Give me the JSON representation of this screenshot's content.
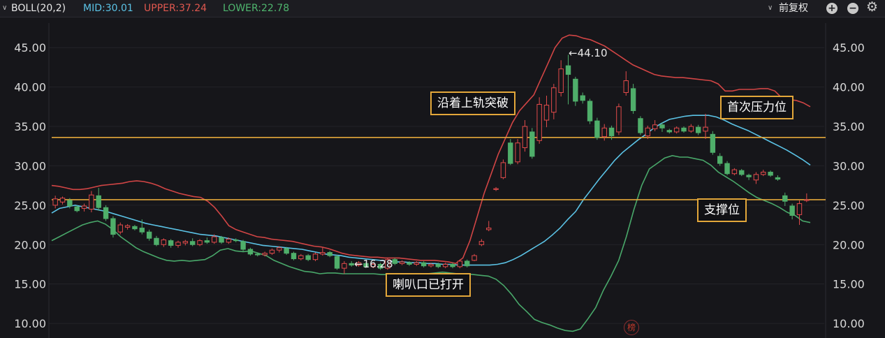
{
  "header": {
    "indicator_label": "BOLL(20,2)",
    "mid_label": "MID:30.01",
    "upper_label": "UPPER:37.24",
    "lower_label": "LOWER:22.78",
    "adjust_label": "前复权"
  },
  "colors": {
    "background": "#16161a",
    "up": "#e24b4b",
    "down": "#4fae6a",
    "upper_band": "#d14545",
    "mid_band": "#5bc3e6",
    "lower_band": "#49a86a",
    "reference_line": "#e3a73a",
    "mid_text": "#5bc3e6",
    "upper_text": "#e0584f",
    "lower_text": "#4fb66e"
  },
  "icons": [
    "chevron-down-icon",
    "chevron-down-icon",
    "zoom-in-icon",
    "zoom-out-icon",
    "gear-icon"
  ],
  "annotations": {
    "breakout": "沿着上轨突破",
    "pressure": "首次压力位",
    "horn": "喇叭口已打开",
    "support": "支撑位",
    "high_mark": "←44.10",
    "low_mark": "←16.28"
  },
  "watermark": "榜",
  "chart_data": {
    "type": "candlestick",
    "ylim": [
      8.5,
      47.5
    ],
    "y_ticks": [
      "45.00",
      "40.00",
      "35.00",
      "30.00",
      "25.00",
      "20.00",
      "15.00",
      "10.00"
    ],
    "y_tick_values": [
      45,
      40,
      35,
      30,
      25,
      20,
      15,
      10
    ],
    "reference_lines": [
      33.6,
      25.7
    ],
    "candles": [
      [
        25.0,
        25.8,
        24.6,
        26.2
      ],
      [
        25.4,
        25.9,
        25.1,
        26.1
      ],
      [
        25.6,
        24.9,
        24.6,
        25.9
      ],
      [
        24.8,
        24.3,
        24.1,
        25.0
      ],
      [
        24.6,
        24.9,
        24.2,
        25.2
      ],
      [
        24.5,
        26.3,
        24.1,
        26.8
      ],
      [
        26.2,
        24.7,
        24.3,
        27.2
      ],
      [
        24.7,
        23.3,
        23.0,
        25.0
      ],
      [
        23.3,
        21.3,
        20.9,
        23.6
      ],
      [
        21.6,
        22.5,
        21.3,
        22.8
      ],
      [
        22.2,
        22.4,
        21.9,
        22.6
      ],
      [
        22.3,
        22.0,
        21.8,
        22.5
      ],
      [
        22.1,
        21.6,
        21.3,
        23.2
      ],
      [
        21.6,
        20.8,
        20.5,
        21.9
      ],
      [
        20.8,
        20.0,
        19.8,
        21.1
      ],
      [
        20.0,
        20.6,
        19.7,
        20.8
      ],
      [
        20.5,
        19.9,
        19.6,
        20.7
      ],
      [
        19.9,
        20.3,
        19.6,
        20.5
      ],
      [
        20.2,
        20.4,
        19.9,
        20.6
      ],
      [
        20.4,
        20.0,
        19.8,
        20.8
      ],
      [
        20.0,
        20.5,
        19.8,
        20.7
      ],
      [
        20.5,
        20.3,
        20.1,
        20.9
      ],
      [
        20.3,
        21.0,
        20.1,
        21.3
      ],
      [
        20.9,
        20.3,
        20.1,
        21.1
      ],
      [
        20.3,
        20.7,
        20.1,
        20.9
      ],
      [
        20.6,
        20.5,
        20.3,
        20.8
      ],
      [
        20.4,
        19.4,
        19.1,
        20.6
      ],
      [
        19.4,
        18.8,
        18.6,
        19.6
      ],
      [
        18.8,
        18.7,
        18.5,
        19.0
      ],
      [
        18.7,
        18.9,
        18.5,
        19.1
      ],
      [
        18.9,
        19.3,
        18.7,
        19.5
      ],
      [
        19.3,
        19.6,
        19.0,
        19.8
      ],
      [
        19.5,
        18.9,
        18.7,
        19.7
      ],
      [
        18.9,
        18.2,
        18.0,
        19.1
      ],
      [
        18.2,
        18.6,
        18.0,
        18.8
      ],
      [
        18.6,
        18.1,
        17.9,
        18.8
      ],
      [
        18.1,
        18.8,
        17.9,
        19.0
      ],
      [
        18.8,
        19.0,
        18.6,
        19.6
      ],
      [
        19.0,
        18.6,
        18.4,
        19.2
      ],
      [
        18.5,
        17.0,
        16.8,
        18.7
      ],
      [
        17.0,
        17.6,
        16.3,
        17.9
      ],
      [
        17.6,
        17.4,
        17.2,
        17.9
      ],
      [
        17.4,
        17.7,
        17.2,
        17.9
      ],
      [
        17.6,
        17.2,
        17.0,
        17.8
      ],
      [
        17.2,
        17.5,
        17.0,
        17.7
      ],
      [
        17.5,
        17.0,
        16.8,
        17.7
      ],
      [
        17.0,
        18.1,
        16.8,
        18.3
      ],
      [
        18.1,
        17.6,
        17.4,
        18.3
      ],
      [
        17.6,
        17.8,
        17.4,
        18.0
      ],
      [
        17.7,
        17.5,
        17.3,
        17.9
      ],
      [
        17.5,
        17.7,
        17.3,
        17.9
      ],
      [
        17.7,
        17.3,
        17.1,
        17.9
      ],
      [
        17.3,
        17.5,
        17.1,
        17.7
      ],
      [
        17.5,
        17.2,
        17.0,
        17.7
      ],
      [
        17.2,
        17.5,
        17.0,
        17.7
      ],
      [
        17.5,
        17.2,
        17.0,
        17.7
      ],
      [
        17.2,
        17.9,
        17.0,
        18.1
      ],
      [
        17.9,
        17.3,
        17.1,
        18.1
      ],
      [
        18.0,
        18.6,
        17.9,
        18.8
      ],
      [
        20.0,
        20.4,
        19.8,
        20.7
      ],
      [
        21.9,
        22.1,
        21.7,
        23.0
      ],
      [
        27.0,
        27.1,
        26.8,
        27.3
      ],
      [
        28.5,
        30.4,
        28.3,
        30.8
      ],
      [
        32.9,
        30.3,
        30.1,
        33.4
      ],
      [
        30.5,
        32.9,
        30.2,
        33.4
      ],
      [
        32.3,
        35.0,
        31.8,
        35.8
      ],
      [
        34.3,
        31.2,
        30.9,
        34.8
      ],
      [
        33.2,
        37.8,
        32.8,
        38.7
      ],
      [
        35.8,
        37.7,
        34.9,
        38.9
      ],
      [
        36.8,
        39.9,
        35.9,
        40.4
      ],
      [
        39.3,
        42.3,
        38.8,
        43.4
      ],
      [
        42.7,
        41.6,
        37.8,
        44.1
      ],
      [
        41.0,
        38.2,
        37.6,
        41.3
      ],
      [
        38.9,
        38.3,
        37.9,
        39.3
      ],
      [
        38.2,
        35.7,
        35.3,
        38.5
      ],
      [
        35.7,
        33.6,
        33.3,
        36.1
      ],
      [
        33.7,
        34.8,
        33.2,
        35.3
      ],
      [
        34.8,
        33.8,
        33.3,
        35.1
      ],
      [
        34.3,
        37.5,
        33.9,
        37.9
      ],
      [
        39.3,
        40.8,
        38.9,
        42.0
      ],
      [
        39.8,
        37.0,
        36.6,
        40.4
      ],
      [
        36.0,
        34.2,
        33.9,
        36.3
      ],
      [
        33.8,
        34.8,
        33.4,
        35.1
      ],
      [
        34.7,
        35.2,
        34.4,
        35.8
      ],
      [
        35.2,
        34.8,
        34.3,
        35.5
      ],
      [
        34.5,
        34.3,
        34.1,
        34.7
      ],
      [
        34.3,
        34.8,
        34.1,
        35.0
      ],
      [
        34.8,
        34.4,
        34.2,
        35.0
      ],
      [
        34.4,
        35.0,
        34.2,
        35.3
      ],
      [
        34.9,
        34.2,
        33.9,
        35.2
      ],
      [
        34.4,
        34.9,
        33.4,
        36.6
      ],
      [
        34.0,
        31.7,
        31.4,
        34.4
      ],
      [
        31.2,
        30.3,
        30.0,
        31.6
      ],
      [
        30.3,
        29.0,
        28.8,
        30.6
      ],
      [
        29.0,
        29.5,
        28.8,
        29.7
      ],
      [
        29.4,
        28.9,
        28.7,
        29.6
      ],
      [
        28.8,
        28.6,
        28.2,
        29.0
      ],
      [
        28.2,
        28.9,
        27.7,
        29.2
      ],
      [
        28.9,
        29.2,
        28.7,
        29.5
      ],
      [
        29.2,
        28.8,
        28.6,
        29.4
      ],
      [
        28.5,
        28.3,
        28.1,
        28.8
      ],
      [
        26.2,
        25.5,
        24.9,
        26.6
      ],
      [
        24.9,
        23.7,
        23.2,
        25.2
      ],
      [
        23.8,
        25.2,
        22.5,
        25.6
      ],
      [
        25.6,
        25.7,
        25.4,
        26.5
      ]
    ],
    "upper_band": [
      27.5,
      27.4,
      27.2,
      27.0,
      27.0,
      27.1,
      27.3,
      27.5,
      27.6,
      27.7,
      27.8,
      28.0,
      28.1,
      28.0,
      27.8,
      27.5,
      27.1,
      26.8,
      26.5,
      26.3,
      26.1,
      26.0,
      25.5,
      24.7,
      23.6,
      22.4,
      21.9,
      21.6,
      21.3,
      21.0,
      20.9,
      20.7,
      20.6,
      20.5,
      20.4,
      20.2,
      20.0,
      19.8,
      19.7,
      19.5,
      19.2,
      18.9,
      18.7,
      18.6,
      18.5,
      18.4,
      18.4,
      18.3,
      18.3,
      18.3,
      18.2,
      18.1,
      18.0,
      18.0,
      18.0,
      17.9,
      17.8,
      17.6,
      18.3,
      20.5,
      23.5,
      26.5,
      29.0,
      31.5,
      33.5,
      35.5,
      37.0,
      38.0,
      39.0,
      41.0,
      43.0,
      45.0,
      46.2,
      46.6,
      46.5,
      46.2,
      46.0,
      45.6,
      45.2,
      44.6,
      44.0,
      43.4,
      42.8,
      42.4,
      42.0,
      41.6,
      41.4,
      41.3,
      41.2,
      41.2,
      41.1,
      41.0,
      40.9,
      40.8,
      40.4,
      39.5,
      39.5,
      39.7,
      39.7,
      39.7,
      39.8,
      39.8,
      39.5,
      38.6,
      38.4,
      38.3,
      38.0,
      37.5
    ],
    "mid_band": [
      24.0,
      24.6,
      24.8,
      25.0,
      24.8,
      24.6,
      24.4,
      24.2,
      23.9,
      23.6,
      23.3,
      23.0,
      22.7,
      22.5,
      22.3,
      22.1,
      21.9,
      21.7,
      21.5,
      21.3,
      21.2,
      21.1,
      20.9,
      20.7,
      20.5,
      20.3,
      20.1,
      19.9,
      19.8,
      19.7,
      19.6,
      19.5,
      19.4,
      19.2,
      19.0,
      18.8,
      18.7,
      18.6,
      18.4,
      18.3,
      18.2,
      18.1,
      18.0,
      17.9,
      17.8,
      17.8,
      17.7,
      17.7,
      17.6,
      17.6,
      17.5,
      17.5,
      17.4,
      17.4,
      17.4,
      17.4,
      17.4,
      17.5,
      17.7,
      18.1,
      18.6,
      19.2,
      19.8,
      20.4,
      21.2,
      22.1,
      23.2,
      24.2,
      25.7,
      27.0,
      28.3,
      29.5,
      30.7,
      31.7,
      32.5,
      33.3,
      34.0,
      34.8,
      35.4,
      35.9,
      36.1,
      36.3,
      36.4,
      36.4,
      36.4,
      36.2,
      35.8,
      35.3,
      34.9,
      34.5,
      34.0,
      33.5,
      33.0,
      32.5,
      32.0,
      31.4,
      30.8,
      30.1
    ],
    "lower_band": [
      20.5,
      21.0,
      21.5,
      22.0,
      22.5,
      22.8,
      23.0,
      22.6,
      21.9,
      21.0,
      20.3,
      19.6,
      19.1,
      18.7,
      18.3,
      18.0,
      17.9,
      18.0,
      17.9,
      18.0,
      18.1,
      18.6,
      19.3,
      19.5,
      19.2,
      19.1,
      19.2,
      18.9,
      18.6,
      18.0,
      17.6,
      17.2,
      16.9,
      16.6,
      16.5,
      16.3,
      16.4,
      16.4,
      16.3,
      16.3,
      16.3,
      16.3,
      16.3,
      16.2,
      16.2,
      16.3,
      16.3,
      16.3,
      16.3,
      16.3,
      16.4,
      16.5,
      16.4,
      16.3,
      16.3,
      16.2,
      16.1,
      16.0,
      15.6,
      14.8,
      13.7,
      12.4,
      11.5,
      10.5,
      10.1,
      9.8,
      9.4,
      9.1,
      9.0,
      9.3,
      10.6,
      12.0,
      14.2,
      16.0,
      18.0,
      21.0,
      24.5,
      27.5,
      29.6,
      30.3,
      31.0,
      31.3,
      31.1,
      31.1,
      30.9,
      30.7,
      30.1,
      29.2,
      28.6,
      28.0,
      27.3,
      26.6,
      26.0,
      25.6,
      25.2,
      24.7,
      24.1,
      23.7,
      23.0,
      22.8
    ]
  }
}
